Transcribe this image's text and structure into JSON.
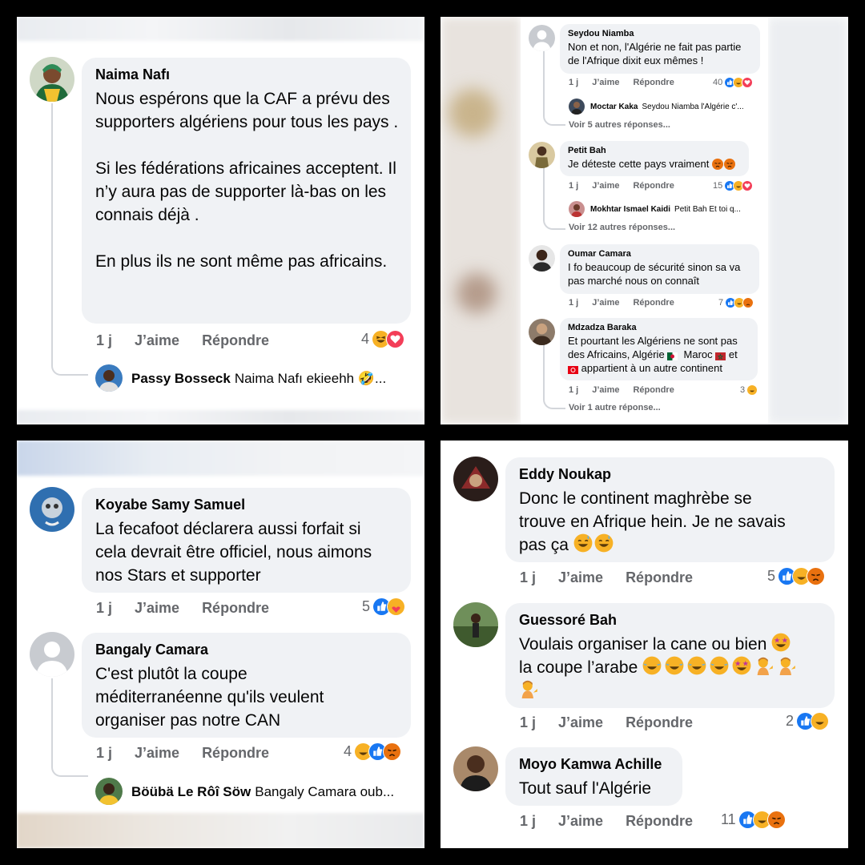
{
  "panel1": {
    "comment": {
      "author": "Naima Nafı",
      "text": "Nous espérons que la CAF a prévu des supporters algériens pour tous les pays .\n\nSi les fédérations africaines acceptent. Il n’y aura pas de supporter là-bas on les connais déjà .\n\nEn plus ils ne sont même pas africains.",
      "time": "1 j",
      "like": "J’aime",
      "reply": "Répondre",
      "count": "4",
      "reactions": [
        "haha",
        "love"
      ]
    },
    "reply": {
      "author": "Passy Bosseck",
      "text": "Naima Nafı ekieehh 🤣..."
    }
  },
  "panel2": {
    "comments": [
      {
        "author": "Seydou Niamba",
        "text": "Non et non, l'Algérie ne fait pas partie\nde l'Afrique dixit eux mêmes !",
        "time": "1 j",
        "like": "J’aime",
        "reply": "Répondre",
        "count": "40",
        "reactions": [
          "like",
          "haha",
          "love"
        ],
        "sub_author": "Moctar Kaka",
        "sub_text": "Seydou Niamba l'Algérie c'...",
        "more": "Voir 5 autres réponses..."
      },
      {
        "author": "Petit Bah",
        "text": "Je déteste cette pays vraiment",
        "time": "1 j",
        "like": "J’aime",
        "reply": "Répondre",
        "count": "15",
        "reactions": [
          "like",
          "haha",
          "love"
        ],
        "sub_author": "Mokhtar Ismael Kaidi",
        "sub_text": "Petit Bah Et toi q...",
        "more": "Voir 12 autres réponses..."
      },
      {
        "author": "Oumar Camara",
        "text": "I fo beaucoup de sécurité sinon sa va\npas marché nous on connaît",
        "time": "1 j",
        "like": "J’aime",
        "reply": "Répondre",
        "count": "7",
        "reactions": [
          "like",
          "haha",
          "angry"
        ]
      },
      {
        "author": "Mdzadza Baraka",
        "text_a": "Et pourtant les Algériens ne sont pas",
        "text_b": "des Africains, Algérie",
        "text_c": "Maroc",
        "text_d": "et",
        "text_e": "appartient à un autre continent",
        "time": "1 j",
        "like": "J’aime",
        "reply": "Répondre",
        "count": "3",
        "reactions": [
          "haha"
        ],
        "more": "Voir 1 autre réponse..."
      }
    ]
  },
  "panel3": {
    "comments": [
      {
        "author": "Koyabe Samy Samuel",
        "text": "La fecafoot déclarera aussi forfait si\ncela devrait être officiel, nous aimons\nnos Stars et supporter",
        "time": "1 j",
        "like": "J’aime",
        "reply": "Répondre",
        "count": "5",
        "reactions": [
          "like",
          "care"
        ]
      },
      {
        "author": "Bangaly Camara",
        "text": "C'est plutôt la coupe\nméditerranéenne qu'ils veulent\norganiser pas notre CAN",
        "time": "1 j",
        "like": "J’aime",
        "reply": "Répondre",
        "count": "4",
        "reactions": [
          "haha",
          "like",
          "angry"
        ]
      }
    ],
    "reply": {
      "author": "Böübä Le Rôî Söw",
      "text": "Bangaly Camara oub..."
    }
  },
  "panel4": {
    "comments": [
      {
        "author": "Eddy Noukap",
        "text_a": "Donc le continent maghrèbe se\ntrouve en Afrique hein. Je ne savais",
        "text_b": "pas ça",
        "time": "1 j",
        "like": "J’aime",
        "reply": "Répondre",
        "count": "5",
        "reactions": [
          "like",
          "haha",
          "angry"
        ]
      },
      {
        "author": "Guessoré Bah",
        "text_a": "Voulais organiser la cane ou bien",
        "text_b": "la coupe l’arabe",
        "time": "1 j",
        "like": "J’aime",
        "reply": "Répondre",
        "count": "2",
        "reactions": [
          "like",
          "haha"
        ]
      },
      {
        "author": "Moyo Kamwa Achille",
        "text": "Tout sauf l'Algérie",
        "time": "1 j",
        "like": "J’aime",
        "reply": "Répondre",
        "count": "11",
        "reactions": [
          "like",
          "haha",
          "angry"
        ]
      }
    ]
  },
  "colors": {
    "like": "#1877f2",
    "love": "#f33e58",
    "yellow": "#f7b125",
    "angry": "#e9710f",
    "bubble": "#f0f2f5",
    "meta": "#65676b"
  }
}
